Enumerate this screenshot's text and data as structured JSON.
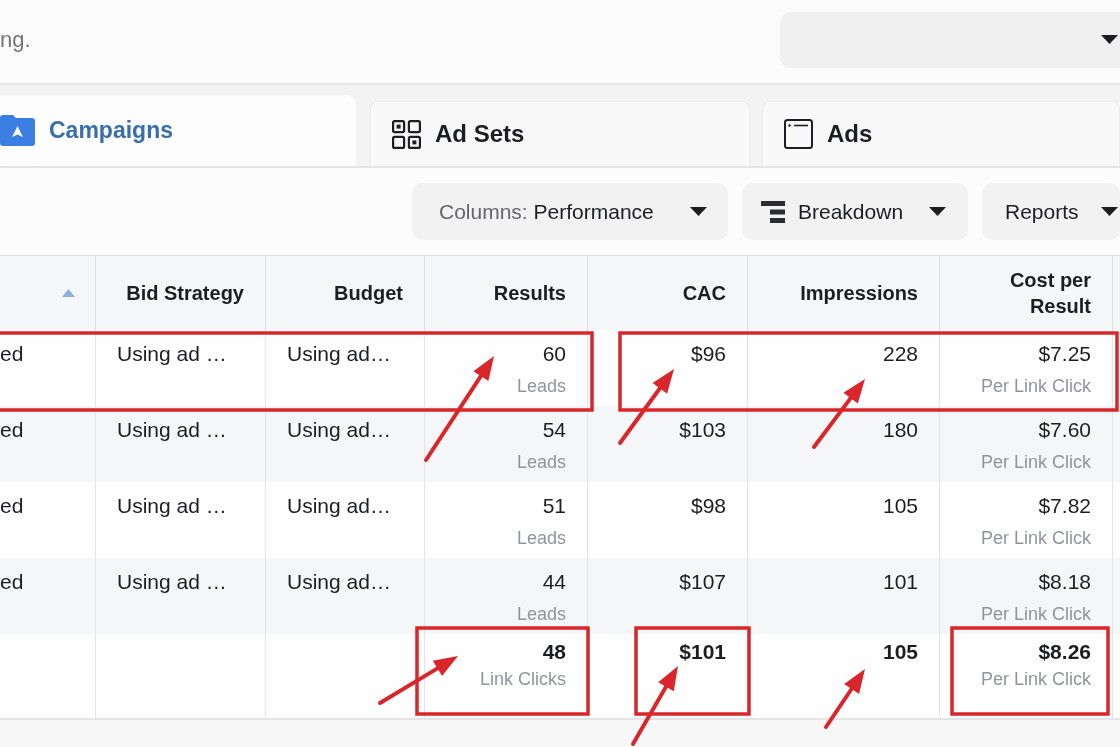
{
  "top_bar": {
    "text": "ng."
  },
  "tabs": [
    {
      "label": "Campaigns",
      "selected": true
    },
    {
      "label": "Ad Sets",
      "selected": false
    },
    {
      "label": "Ads",
      "selected": false
    }
  ],
  "toolbar": [
    {
      "kind": "columns",
      "prefix": "Columns:",
      "label": "Performance"
    },
    {
      "kind": "breakdown",
      "label": "Breakdown"
    },
    {
      "kind": "reports",
      "label": "Reports"
    }
  ],
  "table": {
    "columns": [
      {
        "sort_ascending": true
      },
      {
        "label": "Bid Strategy"
      },
      {
        "label": "Budget"
      },
      {
        "label": "Results"
      },
      {
        "label": "CAC"
      },
      {
        "label": "Impressions"
      },
      {
        "label": "Cost per Result"
      }
    ],
    "rows": [
      {
        "column_1": "ed",
        "bid_strategy": "Using ad …",
        "budget": "Using ad…",
        "results": {
          "value": "60",
          "unit": "Leads"
        },
        "cac": "$96",
        "impressions": "228",
        "cost_per_result": {
          "value": "$7.25",
          "unit": "Per Link Click"
        }
      },
      {
        "column_1": "ed",
        "bid_strategy": "Using ad …",
        "budget": "Using ad…",
        "results": {
          "value": "54",
          "unit": "Leads"
        },
        "cac": "$103",
        "impressions": "180",
        "cost_per_result": {
          "value": "$7.60",
          "unit": "Per Link Click"
        }
      },
      {
        "column_1": "ed",
        "bid_strategy": "Using ad …",
        "budget": "Using ad…",
        "results": {
          "value": "51",
          "unit": "Leads"
        },
        "cac": "$98",
        "impressions": "105",
        "cost_per_result": {
          "value": "$7.82",
          "unit": "Per Link Click"
        }
      },
      {
        "column_1": "ed",
        "bid_strategy": "Using ad …",
        "budget": "Using ad…",
        "results": {
          "value": "44",
          "unit": "Leads"
        },
        "cac": "$107",
        "impressions": "101",
        "cost_per_result": {
          "value": "$8.18",
          "unit": "Per Link Click"
        }
      }
    ],
    "summary": {
      "results": {
        "value": "48",
        "unit": "Link Clicks"
      },
      "cac": "$101",
      "impressions": "105",
      "cost_per_result": {
        "value": "$8.26",
        "unit": "Per Link Click"
      }
    }
  }
}
